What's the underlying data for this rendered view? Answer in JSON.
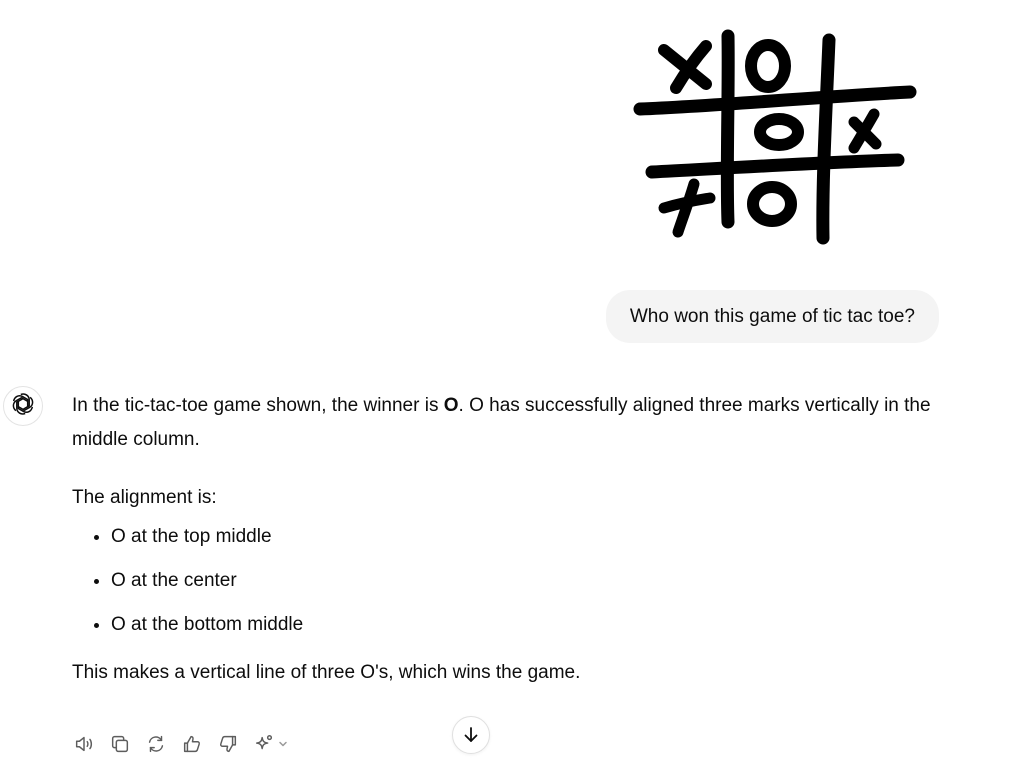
{
  "user_message": {
    "image_icon": "tic-tac-toe-drawing",
    "text": "Who won this game of tic tac toe?"
  },
  "assistant_message": {
    "avatar_icon": "openai-logo-icon",
    "intro_before": "In the tic-tac-toe game shown, the winner is ",
    "intro_bold": "O",
    "intro_after": ". O has successfully aligned three marks vertically in the middle column.",
    "alignment_label": "The alignment is:",
    "bullets": [
      "O at the top middle",
      "O at the center",
      "O at the bottom middle"
    ],
    "conclusion": "This makes a vertical line of three O's, which wins the game."
  },
  "actions": {
    "icons": [
      "read-aloud-icon",
      "copy-icon",
      "regenerate-icon",
      "thumbs-up-icon",
      "thumbs-down-icon",
      "model-switch-icon"
    ]
  },
  "scroll_button": {
    "icon": "arrow-down-icon"
  },
  "colors": {
    "bubble_bg": "#f4f4f4",
    "text": "#0d0d0d",
    "icon_gray": "#5d5d5d"
  }
}
